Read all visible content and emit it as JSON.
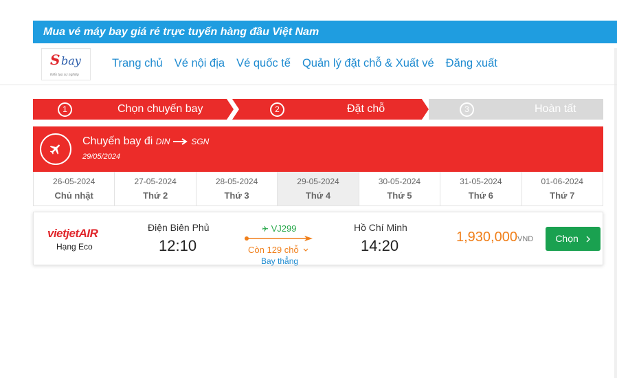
{
  "banner": {
    "text": "Mua vé máy bay giá rẻ trực tuyến hàng đầu Việt Nam"
  },
  "logo": {
    "mark_s": "S",
    "mark_bay": "bay",
    "tagline": "Kiến tạo sự nghiệp"
  },
  "nav": {
    "items": [
      {
        "label": "Trang chủ"
      },
      {
        "label": "Vé nội địa"
      },
      {
        "label": "Vé quốc tế"
      },
      {
        "label": "Quản lý đặt chỗ & Xuất vé"
      },
      {
        "label": "Đăng xuất"
      }
    ]
  },
  "steps": [
    {
      "num": "1",
      "label": "Chọn chuyến bay",
      "state": "done"
    },
    {
      "num": "2",
      "label": "Đặt chỗ",
      "state": "current"
    },
    {
      "num": "3",
      "label": "Hoàn tất",
      "state": "pending"
    }
  ],
  "flight_header": {
    "title": "Chuyến bay đi",
    "from_code": "DIN",
    "to_code": "SGN",
    "date": "29/05/2024"
  },
  "dates": [
    {
      "date": "26-05-2024",
      "weekday": "Chủ nhật"
    },
    {
      "date": "27-05-2024",
      "weekday": "Thứ 2"
    },
    {
      "date": "28-05-2024",
      "weekday": "Thứ 3"
    },
    {
      "date": "29-05-2024",
      "weekday": "Thứ 4",
      "selected": true
    },
    {
      "date": "30-05-2024",
      "weekday": "Thứ 5"
    },
    {
      "date": "31-05-2024",
      "weekday": "Thứ 6"
    },
    {
      "date": "01-06-2024",
      "weekday": "Thứ 7"
    }
  ],
  "flight": {
    "airline": "vietjetAIR",
    "class": "Hạng Eco",
    "from_city": "Điện Biên Phủ",
    "depart_time": "12:10",
    "to_city": "Hồ Chí Minh",
    "arrive_time": "14:20",
    "flight_no": "VJ299",
    "seats": "Còn 129 chỗ",
    "stops": "Bay thẳng",
    "price": "1,930,000",
    "currency": "VND",
    "select_label": "Chọn"
  },
  "colors": {
    "brand_blue": "#1f9de0",
    "brand_red": "#ea2c2a",
    "green": "#1aa150",
    "orange": "#f07f1a"
  }
}
